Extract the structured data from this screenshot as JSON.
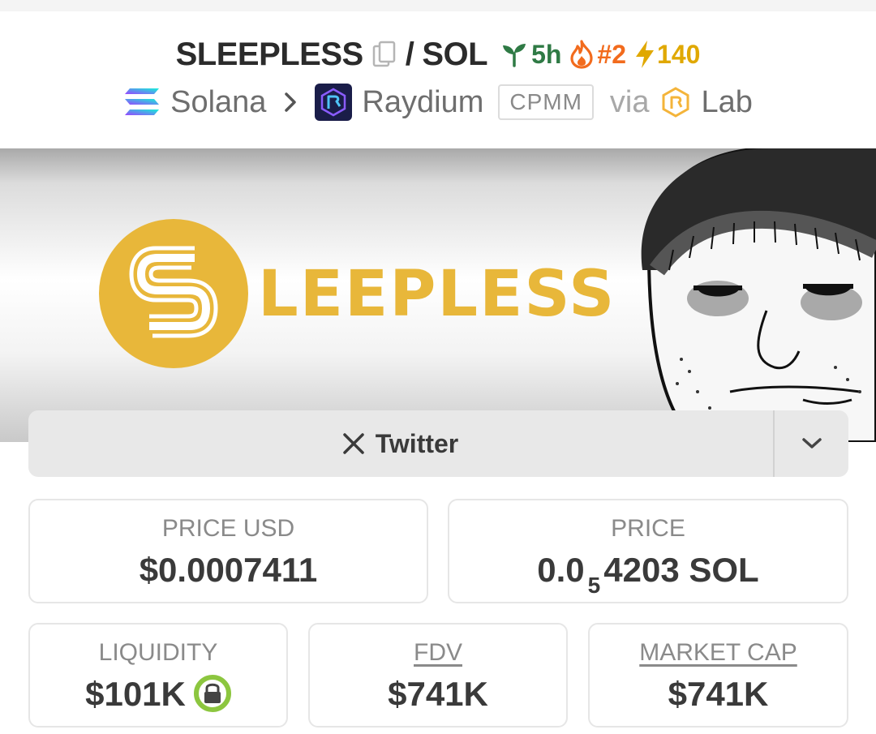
{
  "header": {
    "base_symbol": "SLEEPLESS",
    "separator": "/",
    "quote_symbol": "SOL",
    "age": "5h",
    "trending_rank": "#2",
    "boosts": "140",
    "chain": "Solana",
    "dex": "Raydium",
    "pool_type": "CPMM",
    "via": "via",
    "launchpad": "Lab"
  },
  "banner": {
    "logo_letter": "S",
    "word": "LEEPLESS"
  },
  "socials": {
    "twitter_label": "Twitter"
  },
  "stats": {
    "price_usd_label": "PRICE USD",
    "price_usd_value": "$0.0007411",
    "price_label": "PRICE",
    "price_prefix": "0.0",
    "price_zero_count": "5",
    "price_digits": "4203 SOL",
    "liquidity_label": "LIQUIDITY",
    "liquidity_value": "$101K",
    "fdv_label": "FDV",
    "fdv_value": "$741K",
    "mcap_label": "MARKET CAP",
    "mcap_value": "$741K"
  },
  "colors": {
    "age_green": "#2f7a45",
    "trend_orange": "#f26b1d",
    "boost_yellow": "#e0a800",
    "brand_gold": "#e8b73a",
    "lock_green": "#8cc63f"
  },
  "icons": [
    "copy-icon",
    "seedling-icon",
    "flame-icon",
    "lightning-icon",
    "solana-icon",
    "chevron-right-icon",
    "raydium-icon",
    "raydium-lab-icon",
    "x-icon",
    "chevron-down-icon",
    "lock-icon"
  ]
}
